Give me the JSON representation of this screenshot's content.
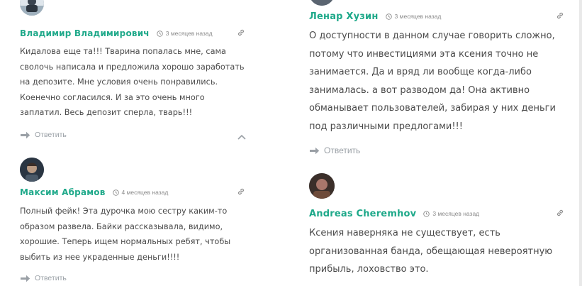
{
  "reply_label": "Ответить",
  "accent_color": "#1fa98a",
  "left_comments": [
    {
      "author": "Владимир Владимирович",
      "time": "3 месяцев назад",
      "text": "Кидалова еще та!!! Тварина попалась мне, сама сволочь написала и предложила хорошо заработать на депозите. Мне условия очень понравились. Коенечно согласился. И за это очень много заплатил. Весь депозит сперла, тварь!!!"
    },
    {
      "author": "Максим Абрамов",
      "time": "4 месяцев назад",
      "text": "Полный фейк! Эта дурочка мою сестру каким-то образом развела. Байки рассказывала, видимо, хорошие. Теперь ищем нормальных ребят, чтобы выбить из нее украденные деньги!!!!"
    }
  ],
  "right_comments": [
    {
      "author": "Ленар Хузин",
      "time": "3 месяцев назад",
      "text": "О доступности в данном случае говорить сложно, потому что инвестициями эта ксения точно не занимается. Да и вряд ли вообще когда-либо занималась. а вот разводом да! Она активно обманывает пользователей, забирая у них деньги под различными предлогами!!!"
    },
    {
      "author": "Andreas Cheremhov",
      "time": "3 месяцев назад",
      "text": "Ксения наверняка не существует, есть организованная банда, обещающая невероятную прибыль, лоховство это."
    }
  ]
}
